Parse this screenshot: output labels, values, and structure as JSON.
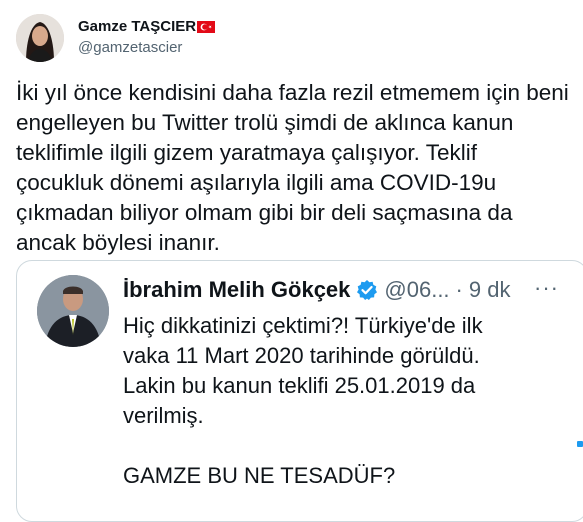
{
  "author": {
    "display_name": "Gamze TAŞCIER",
    "handle": "@gamzetascier",
    "flag_icon": "turkey-flag-icon"
  },
  "tweet": {
    "lines": [
      "İki yıl önce kendisini daha fazla rezil etmemem için beni",
      "engelleyen bu Twitter trolü şimdi de aklınca kanun",
      "teklifimle ilgili gizem yaratmaya çalışıyor. Teklif",
      "çocukluk dönemi aşılarıyla ilgili ama COVID-19u",
      "çıkmadan biliyor olmam gibi bir deli saçmasına da",
      "ancak böylesi inanır."
    ]
  },
  "quoted_tweet": {
    "display_name": "İbrahim Melih Gökçek",
    "handle": "@06...",
    "separator": "·",
    "time": "9 dk",
    "more_icon": "more-horizontal-icon",
    "verified_icon": "verified-badge-icon",
    "lines": [
      "Hiç dikkatinizi çektimi?! Türkiye'de ilk",
      "vaka 11 Mart 2020 tarihinde görüldü.",
      "Lakin bu kanun teklifi 25.01.2019 da",
      "verilmiş."
    ],
    "closing_line": "GAMZE BU NE TESADÜF?"
  },
  "colors": {
    "text": "#0f1419",
    "secondary": "#536471",
    "border": "#cfd9de",
    "verified_blue": "#1d9bf0",
    "flag_red": "#e30a17"
  }
}
